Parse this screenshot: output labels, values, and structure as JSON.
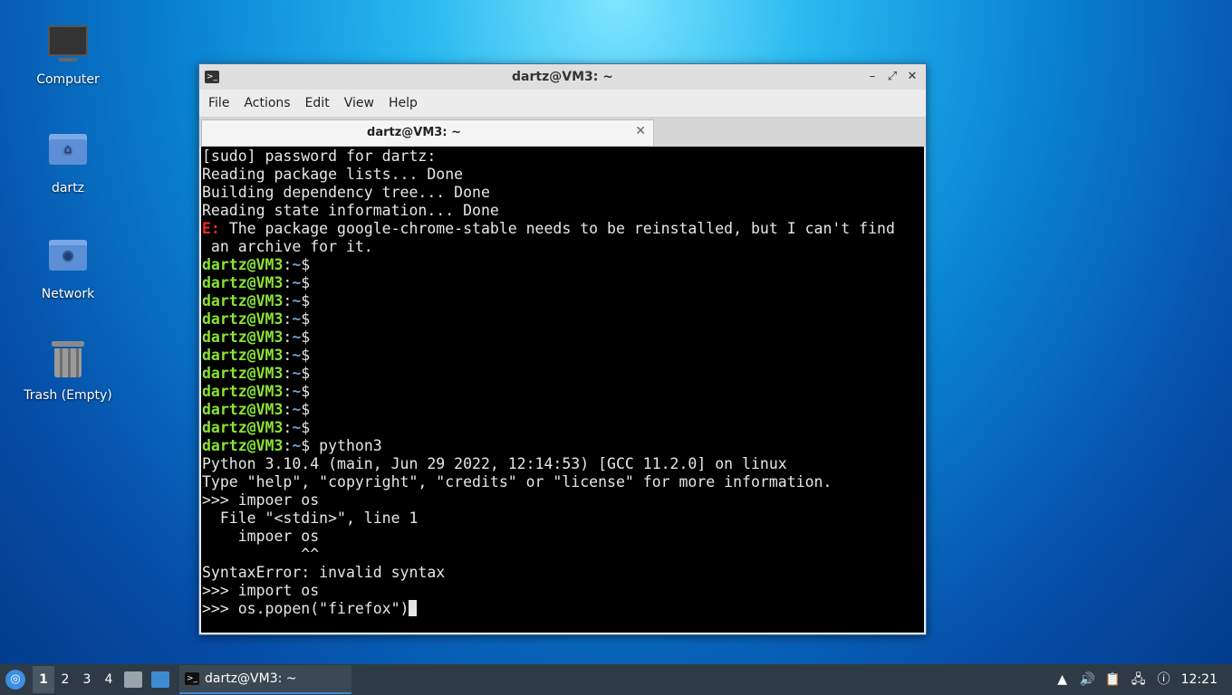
{
  "desktop": {
    "icons": [
      {
        "label": "Computer"
      },
      {
        "label": "dartz"
      },
      {
        "label": "Network"
      },
      {
        "label": "Trash (Empty)"
      }
    ]
  },
  "window": {
    "title": "dartz@VM3: ~",
    "menu": [
      "File",
      "Actions",
      "Edit",
      "View",
      "Help"
    ],
    "tab_label": "dartz@VM3: ~",
    "controls": {
      "minimize": "–",
      "maximize": "⤢",
      "close": "✕"
    }
  },
  "terminal": {
    "lines": [
      "[sudo] password for dartz:",
      "Reading package lists... Done",
      "Building dependency tree... Done",
      "Reading state information... Done"
    ],
    "error_prefix": "E:",
    "error_text": " The package google-chrome-stable needs to be reinstalled, but I can't find",
    "error_cont": " an archive for it.",
    "prompt_user": "dartz@VM3",
    "prompt_sep": ":",
    "prompt_path": "~",
    "prompt_sym": "$",
    "python_cmd": " python3",
    "output": [
      "Python 3.10.4 (main, Jun 29 2022, 12:14:53) [GCC 11.2.0] on linux",
      "Type \"help\", \"copyright\", \"credits\" or \"license\" for more information.",
      ">>> impoer os",
      "  File \"<stdin>\", line 1",
      "    impoer os",
      "           ^^",
      "SyntaxError: invalid syntax",
      ">>> import os"
    ],
    "current_input": ">>> os.popen(\"firefox\")"
  },
  "taskbar": {
    "workspaces": [
      "1",
      "2",
      "3",
      "4"
    ],
    "task_label": "dartz@VM3: ~",
    "clock": "12:21"
  }
}
